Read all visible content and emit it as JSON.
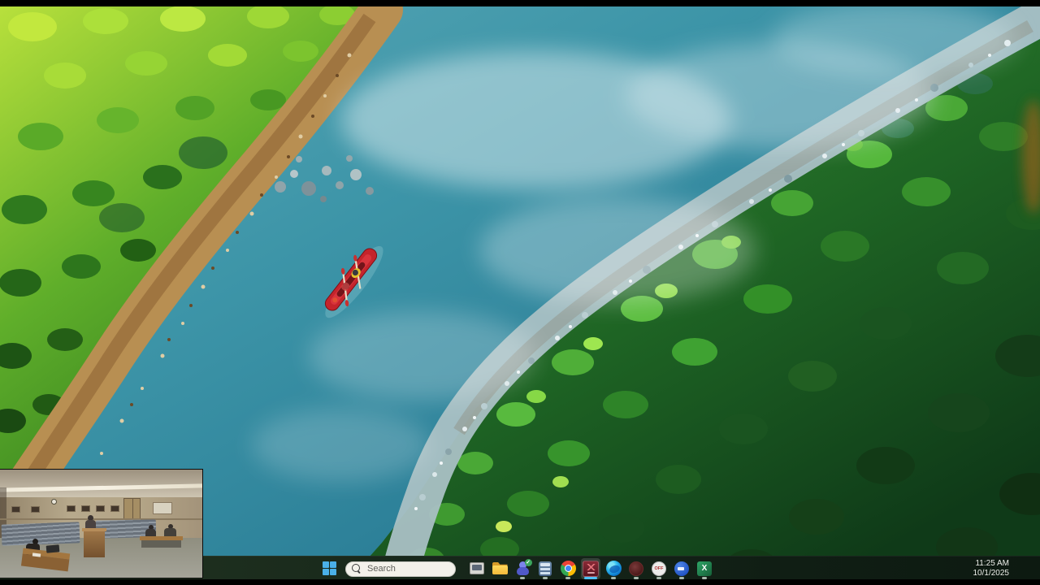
{
  "taskbar": {
    "search": {
      "placeholder": "Search"
    },
    "apps": [
      {
        "name": "this-pc"
      },
      {
        "name": "file-explorer"
      },
      {
        "name": "teams"
      },
      {
        "name": "calculator"
      },
      {
        "name": "chrome"
      },
      {
        "name": "broadcast-app",
        "active": true
      },
      {
        "name": "edge"
      },
      {
        "name": "recorder-app"
      },
      {
        "name": "on-off-app",
        "label": "OFF"
      },
      {
        "name": "meeting-app"
      },
      {
        "name": "excel"
      }
    ],
    "clock": {
      "time": "11:25 AM",
      "date": "10/1/2025"
    }
  },
  "wallpaper": {
    "description": "Aerial view of a turquoise river with a red tandem kayak, sunlit lime forest and tan shore on the upper-left, pebble gravel bar and dark evergreen forest on the lower-right, white mist over the water",
    "colors": {
      "water": "#3391a4",
      "mist": "#ffffff",
      "forest_bright": "#aade3a",
      "forest_dark": "#17511e",
      "shore": "#b5894e",
      "gravel": "#a9c0c4",
      "kayak": "#c4242c"
    }
  },
  "video_overlay": {
    "description": "Live video feed of a council chamber: speaker at wooden podium, two officials seated at a table on the right, clerk at a desk on the left, rows of empty chairs, framed pictures and clock on the back wall"
  }
}
